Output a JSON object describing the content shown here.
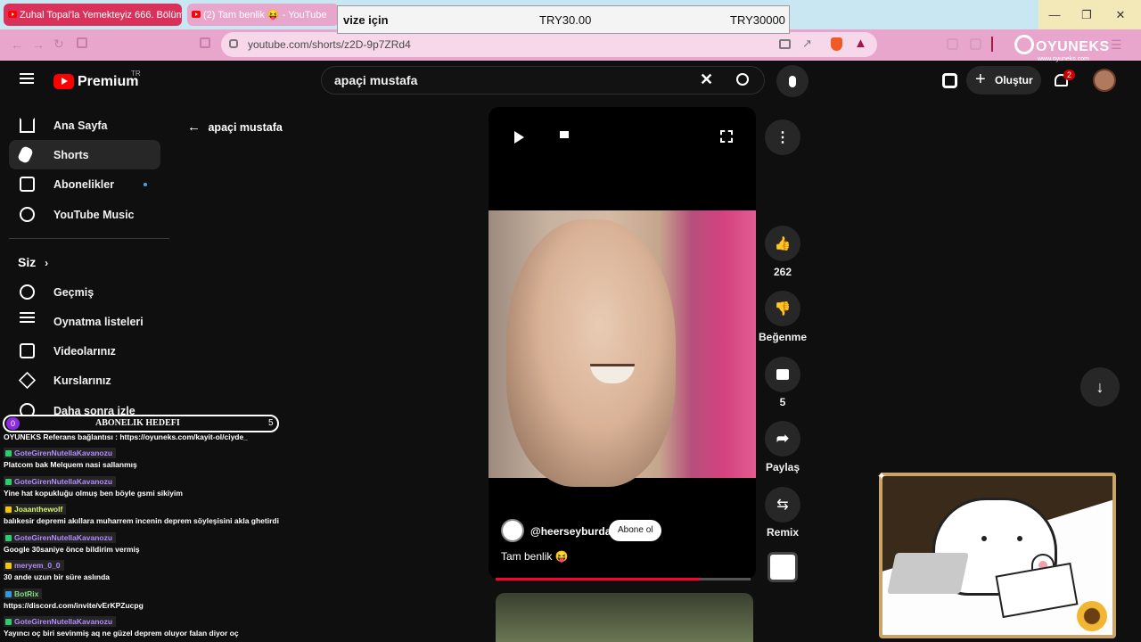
{
  "browser": {
    "tabs": [
      {
        "title": "Zuhal Topal'la Yemekteyiz 666. Bölüm",
        "active": false
      },
      {
        "title": "(2) Tam benlik 😝 - YouTube",
        "active": true
      }
    ],
    "url": "youtube.com/shorts/z2D-9p7ZRd4",
    "colors": {
      "tabbar": "#c9e7f3",
      "toolbar": "#e9a6cd",
      "active_tab": "#d9315a"
    }
  },
  "stream_overlay": {
    "goal_label": "vize için",
    "goal_current": "TRY30.00",
    "goal_target": "TRY30000",
    "logo_text": "OYUNEKS",
    "logo_url": "www.oyuneks.com",
    "sub_goal": {
      "label": "ABONELIK HEDEFI",
      "current": "0",
      "target": "5"
    }
  },
  "youtube": {
    "brand": "Premium",
    "region": "TR",
    "search_value": "apaçi mustafa",
    "create_label": "Oluştur",
    "notifications_count": "2",
    "back_query": "apaçi mustafa",
    "sidebar": {
      "main": [
        {
          "label": "Ana Sayfa",
          "icon": "home-icon"
        },
        {
          "label": "Shorts",
          "icon": "shorts-icon",
          "active": true
        },
        {
          "label": "Abonelikler",
          "icon": "subscriptions-icon"
        },
        {
          "label": "YouTube Music",
          "icon": "music-icon"
        }
      ],
      "you_header": "Siz",
      "you": [
        {
          "label": "Geçmiş",
          "icon": "history-icon"
        },
        {
          "label": "Oynatma listeleri",
          "icon": "playlist-icon"
        },
        {
          "label": "Videolarınız",
          "icon": "video-icon"
        },
        {
          "label": "Kurslarınız",
          "icon": "course-icon"
        },
        {
          "label": "Daha sonra izle",
          "icon": "clock-icon"
        }
      ]
    },
    "short": {
      "channel": "@heerseyburda",
      "subscribe_label": "Abone ol",
      "caption": "Tam benlik 😝",
      "progress": 0.8
    },
    "actions": {
      "likes": "262",
      "dislike_label": "Beğenme",
      "comments": "5",
      "share_label": "Paylaş",
      "remix_label": "Remix"
    }
  },
  "chat": [
    {
      "user": "",
      "text": "OYUNEKS Referans bağlantısı : https://oyuneks.com/kayit-ol/ciyde_"
    },
    {
      "user": "GoteGirenNutellaKavanozu",
      "text": "Platcom bak Melquem nasi sallanmış"
    },
    {
      "user": "GoteGirenNutellaKavanozu",
      "text": "Yine hat kopukluğu olmuş ben böyle gsmi sikiyim"
    },
    {
      "user": "Joaanthewolf",
      "text": "balıkesir depremi akıllara muharrem incenin deprem söyleşisini akla ghetirdi"
    },
    {
      "user": "GoteGirenNutellaKavanozu",
      "text": "Google 30saniye önce bildirim vermiş"
    },
    {
      "user": "meryem_0_0",
      "text": "30 ande uzun bir süre aslında"
    },
    {
      "user": "BotRix",
      "text": "https://discord.com/invite/vErKPZucpg"
    },
    {
      "user": "GoteGirenNutellaKavanozu",
      "text": "Yayıncı oç biri sevinmiş aq ne güzel deprem oluyor falan diyor oç"
    }
  ]
}
